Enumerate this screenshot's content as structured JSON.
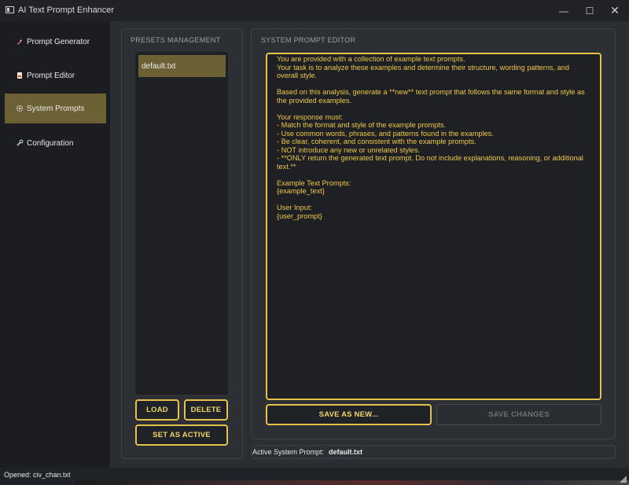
{
  "window": {
    "title": "AI Text Prompt Enhancer",
    "minimize_glyph": "—",
    "maximize_glyph": "☐",
    "close_glyph": "✕"
  },
  "sidebar": {
    "items": [
      {
        "label": "Prompt Generator",
        "icon": "rocket-icon",
        "active": false
      },
      {
        "label": "Prompt Editor",
        "icon": "document-icon",
        "active": false
      },
      {
        "label": "System Prompts",
        "icon": "gear-icon",
        "active": true
      },
      {
        "label": "Configuration",
        "icon": "wrench-icon",
        "active": false
      }
    ]
  },
  "presets": {
    "title": "PRESETS MANAGEMENT",
    "items": [
      "default.txt"
    ],
    "selected": "default.txt",
    "load_label": "LOAD",
    "delete_label": "DELETE",
    "set_active_label": "SET AS ACTIVE"
  },
  "editor": {
    "title": "SYSTEM PROMPT EDITOR",
    "content": "You are provided with a collection of example text prompts.\nYour task is to analyze these examples and determine their structure, wording patterns, and overall style.\n\nBased on this analysis, generate a **new** text prompt that follows the same format and style as the provided examples.\n\nYour response must:\n- Match the format and style of the example prompts.\n- Use common words, phrases, and patterns found in the examples.\n- Be clear, coherent, and consistent with the example prompts.\n- NOT introduce any new or unrelated styles.\n- **ONLY return the generated text prompt. Do not include explanations, reasoning, or additional text.**\n\nExample Text Prompts:\n{example_text}\n\nUser Input:\n{user_prompt}",
    "save_as_new_label": "SAVE AS NEW...",
    "save_changes_label": "SAVE CHANGES",
    "save_changes_enabled": false
  },
  "active_prompt": {
    "label": "Active System Prompt:",
    "value": "default.txt"
  },
  "status_bar": {
    "text": "Opened: civ_chan.txt"
  },
  "colors": {
    "accent": "#e6c24a",
    "active_bg": "#6b6134",
    "editor_text": "#f0c84a"
  }
}
